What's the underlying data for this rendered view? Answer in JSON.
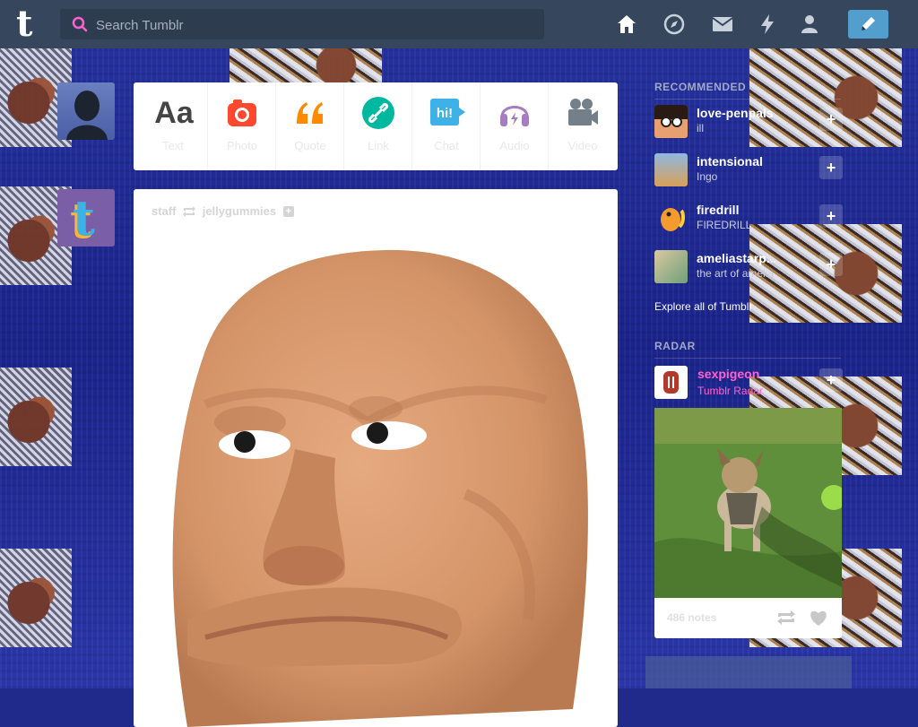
{
  "search": {
    "placeholder": "Search Tumblr"
  },
  "nav": {
    "icons": [
      "home-icon",
      "compass-icon",
      "mail-icon",
      "lightning-icon",
      "user-icon",
      "pencil-icon"
    ]
  },
  "post_types": [
    {
      "label": "Text",
      "icon": "text-icon",
      "color": "#444444"
    },
    {
      "label": "Photo",
      "icon": "camera-icon",
      "color": "#ff492f"
    },
    {
      "label": "Quote",
      "icon": "quote-icon",
      "color": "#ff8a00"
    },
    {
      "label": "Link",
      "icon": "link-icon",
      "color": "#00b8a0"
    },
    {
      "label": "Chat",
      "icon": "chat-icon",
      "color": "#3eb1e6"
    },
    {
      "label": "Audio",
      "icon": "headphones-icon",
      "color": "#a77dc2"
    },
    {
      "label": "Video",
      "icon": "video-camera-icon",
      "color": "#748089"
    }
  ],
  "post": {
    "author": "staff",
    "reblogged_from": "jellygummies"
  },
  "sidebar": {
    "recommended_title": "RECOMMENDED",
    "recommended": [
      {
        "name": "love-penpals",
        "sub": "ill"
      },
      {
        "name": "intensional",
        "sub": "Ingo"
      },
      {
        "name": "firedrill",
        "sub": "FIREDRILL"
      },
      {
        "name": "ameliastarp...",
        "sub": "the art of amelia"
      }
    ],
    "explore": "Explore all of Tumblr",
    "radar_title": "RADAR",
    "radar": {
      "name": "sexpigeon",
      "sub": "Tumblr Radar",
      "notes": "486 notes"
    }
  },
  "colors": {
    "topbar": "#36465d",
    "compose": "#529ecc",
    "radar_accent": "#ff62ce"
  }
}
